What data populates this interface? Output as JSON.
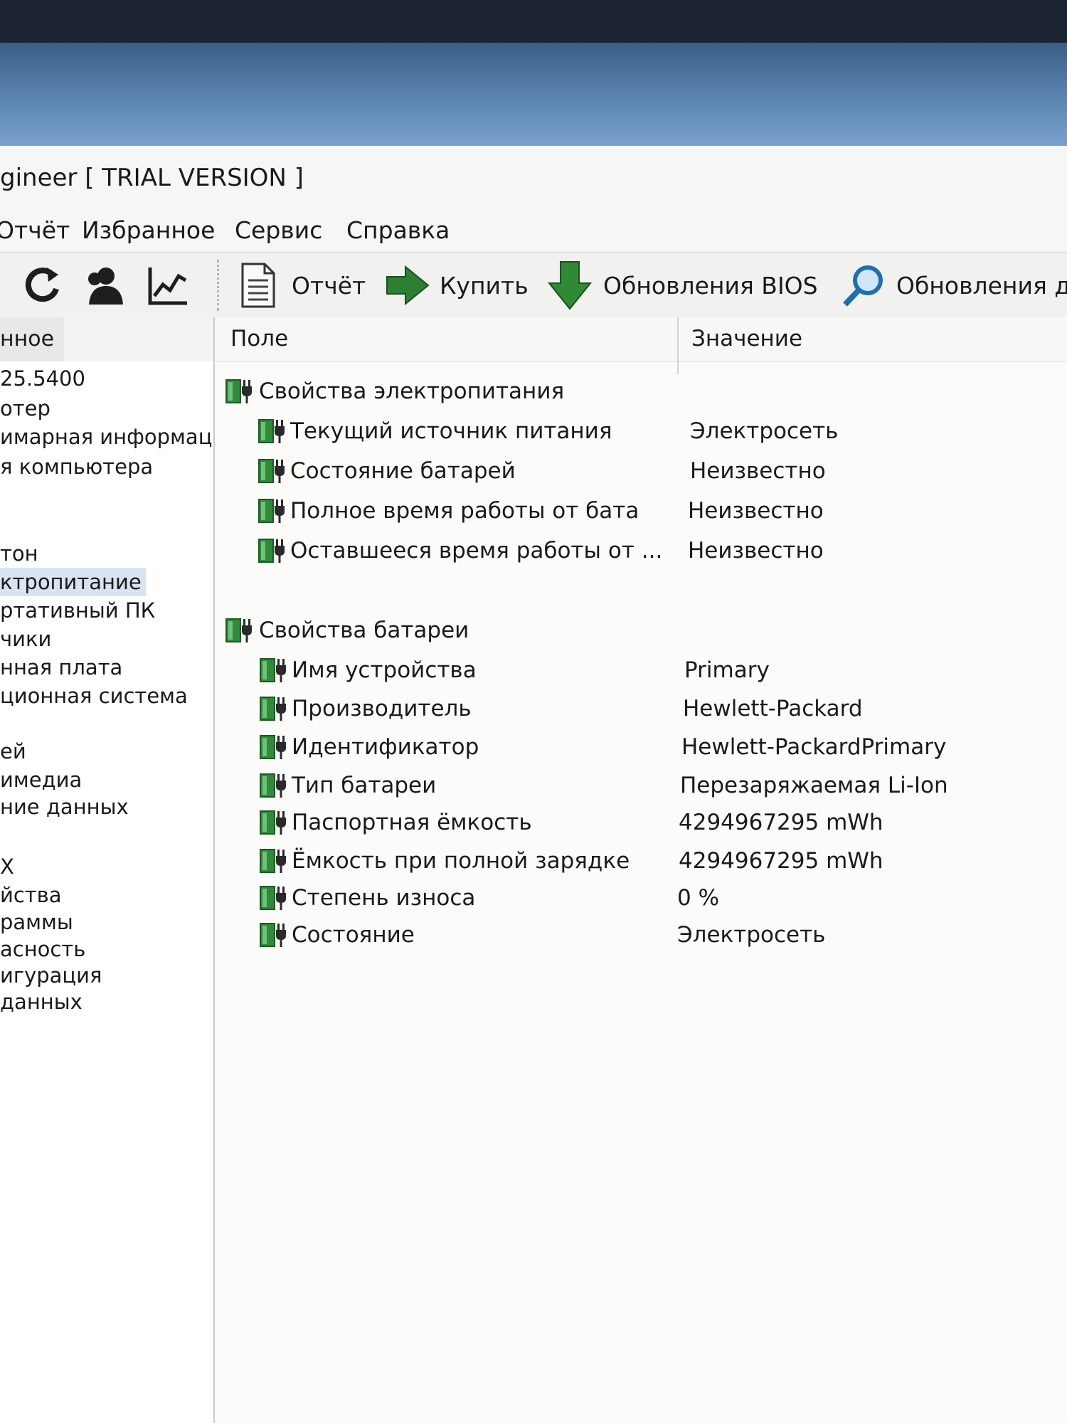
{
  "window": {
    "title": "gineer  [ TRIAL VERSION ]"
  },
  "menu": [
    "Отчёт",
    "Избранное",
    "Сервис",
    "Справка"
  ],
  "toolbar": {
    "report": "Отчёт",
    "buy": "Купить",
    "bios_updates": "Обновления BIOS",
    "driver_updates": "Обновления д"
  },
  "sidebar": {
    "header": "нное",
    "items": [
      "25.5400",
      "отер",
      "имарная информац",
      "я компьютера",
      "",
      "",
      "тон",
      "ктропитание",
      "ртативный ПК",
      "чики",
      "нная плата",
      "ционная система",
      "",
      "ей",
      "имедиа",
      "ние данных",
      "",
      "Х",
      "йства",
      "раммы",
      "асность",
      "игурация",
      "данных",
      ""
    ],
    "selected_index": 7
  },
  "table": {
    "col_field": "Поле",
    "col_value": "Значение",
    "group1": {
      "title": "Свойства электропитания",
      "rows": [
        {
          "field": "Текущий источник питания",
          "value": "Электросеть"
        },
        {
          "field": "Состояние батарей",
          "value": "Неизвестно"
        },
        {
          "field": "Полное время работы от бата",
          "value": "Неизвестно"
        },
        {
          "field": "Оставшееся время работы от ...",
          "value": "Неизвестно"
        }
      ]
    },
    "group2": {
      "title": "Свойства батареи",
      "rows": [
        {
          "field": "Имя устройства",
          "value": "Primary"
        },
        {
          "field": "Производитель",
          "value": "Hewlett-Packard"
        },
        {
          "field": "Идентификатор",
          "value": "Hewlett-PackardPrimary"
        },
        {
          "field": "Тип батареи",
          "value": "Перезаряжаемая Li-Ion"
        },
        {
          "field": "Паспортная ёмкость",
          "value": "4294967295 mWh"
        },
        {
          "field": "Ёмкость при полной зарядке",
          "value": "4294967295 mWh"
        },
        {
          "field": "Степень износа",
          "value": "0 %"
        },
        {
          "field": "Состояние",
          "value": "Электросеть"
        }
      ]
    }
  },
  "colors": {
    "battery_green": "#2f8a3a",
    "plug_dark": "#2a2a2a",
    "selection": "#d9e4f2"
  }
}
